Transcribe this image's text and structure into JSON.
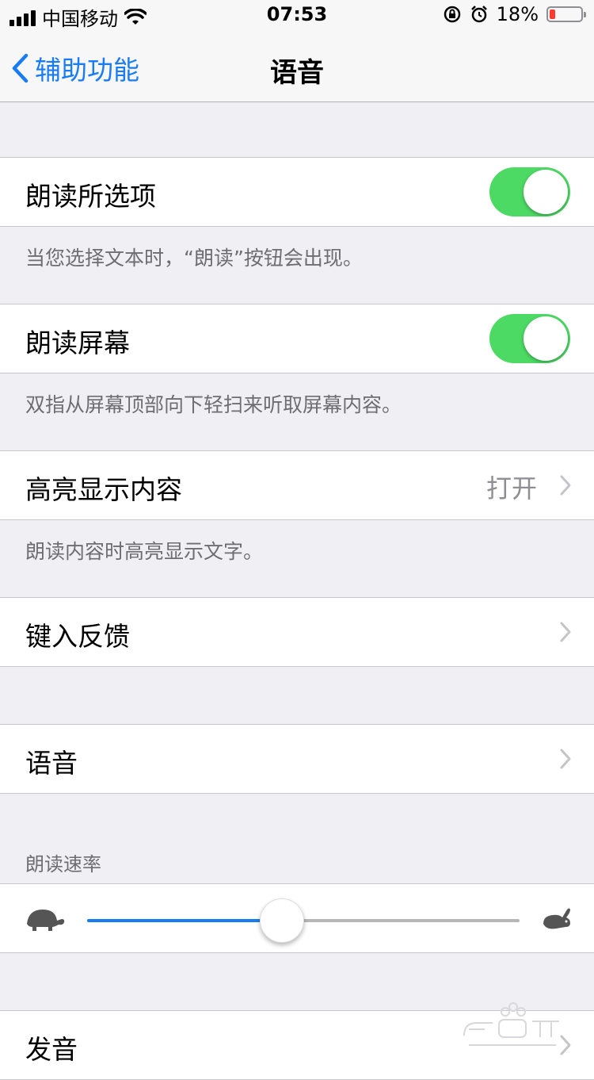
{
  "status": {
    "carrier": "中国移动",
    "time": "07:53",
    "battery": "18%",
    "battery_fraction": 0.18
  },
  "nav": {
    "back_label": "辅助功能",
    "title": "语音"
  },
  "rows": {
    "speak_selection": {
      "label": "朗读所选项",
      "on": true,
      "footer": "当您选择文本时，“朗读”按钮会出现。"
    },
    "speak_screen": {
      "label": "朗读屏幕",
      "on": true,
      "footer": "双指从屏幕顶部向下轻扫来听取屏幕内容。"
    },
    "highlight": {
      "label": "高亮显示内容",
      "value": "打开",
      "footer": "朗读内容时高亮显示文字。"
    },
    "typing_feedback": {
      "label": "键入反馈"
    },
    "voices": {
      "label": "语音"
    },
    "speaking_rate": {
      "header": "朗读速率",
      "value": 0.45
    },
    "pronunciations": {
      "label": "发音"
    }
  },
  "colors": {
    "accent": "#1a7cf5",
    "switch_on": "#4cd964",
    "background": "#efeff4"
  },
  "icons": {
    "back": "chevron-left-icon",
    "disclosure": "chevron-right-icon",
    "slow": "tortoise-icon",
    "fast": "hare-icon"
  }
}
